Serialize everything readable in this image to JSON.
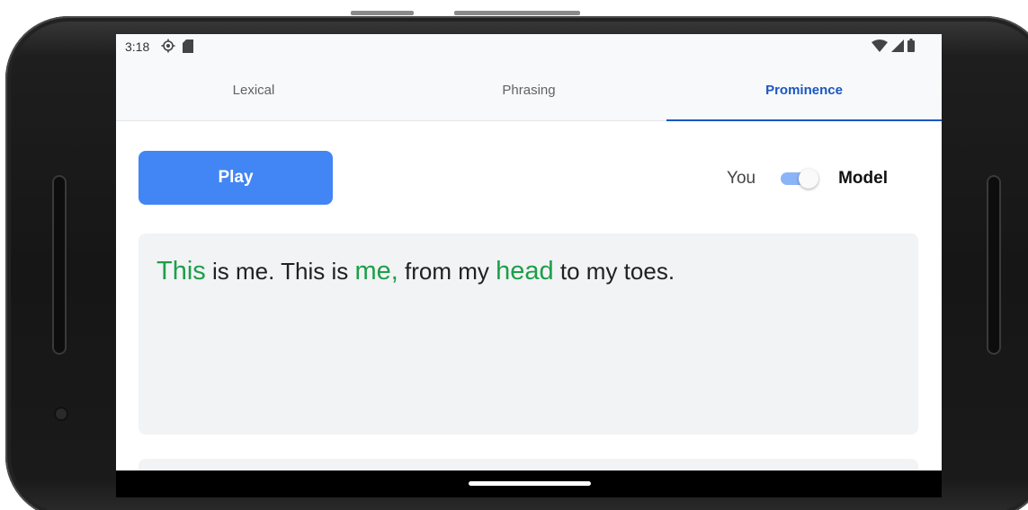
{
  "status_bar": {
    "time": "3:18"
  },
  "tabs": [
    {
      "label": "Lexical",
      "active": false
    },
    {
      "label": "Phrasing",
      "active": false
    },
    {
      "label": "Prominence",
      "active": true
    }
  ],
  "controls": {
    "play_label": "Play",
    "toggle_left_label": "You",
    "toggle_right_label": "Model",
    "toggle_on": true
  },
  "sentence": {
    "segments": [
      {
        "text": "This",
        "prominent": true
      },
      {
        "text": " is me. This is ",
        "prominent": false
      },
      {
        "text": "me,",
        "prominent": true
      },
      {
        "text": " from my ",
        "prominent": false
      },
      {
        "text": "head",
        "prominent": true
      },
      {
        "text": " to my toes.",
        "prominent": false
      }
    ]
  },
  "colors": {
    "accent": "#1a56c4",
    "play_button": "#4285f4",
    "prominent_word": "#1e9e4a",
    "card_background": "#f1f3f4"
  }
}
